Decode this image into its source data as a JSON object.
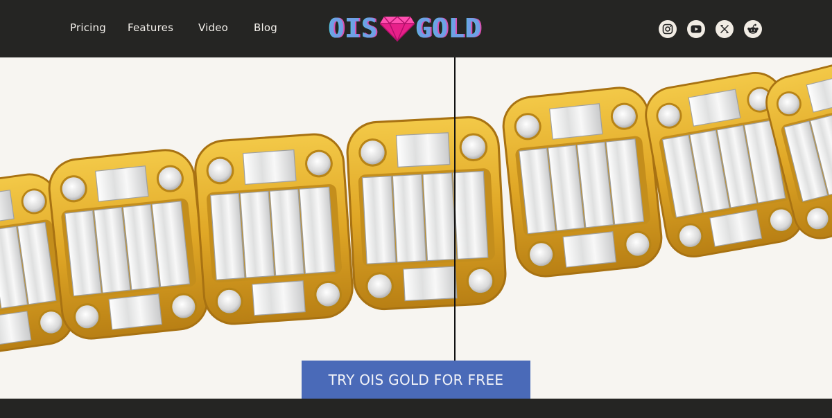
{
  "nav": {
    "items": [
      {
        "label": "Pricing"
      },
      {
        "label": "Features"
      },
      {
        "label": "Video"
      },
      {
        "label": "Blog"
      }
    ]
  },
  "logo": {
    "left_text": "OIS",
    "right_text": "GOLD",
    "gem_icon": "diamond-icon",
    "colors": {
      "primary": "#6fa0e6",
      "gem": "#e8208a"
    }
  },
  "social": {
    "icons": [
      "instagram-icon",
      "youtube-icon",
      "x-icon",
      "reddit-icon"
    ]
  },
  "hero": {
    "image": "gold-diamond-bracelet-comparison",
    "cta_label": "TRY OIS GOLD FOR FREE",
    "cta_color": "#4a6ab8"
  },
  "theme": {
    "header_bg": "#252523",
    "hero_bg": "#f7f5f1",
    "gold": "#e0aa2a"
  }
}
